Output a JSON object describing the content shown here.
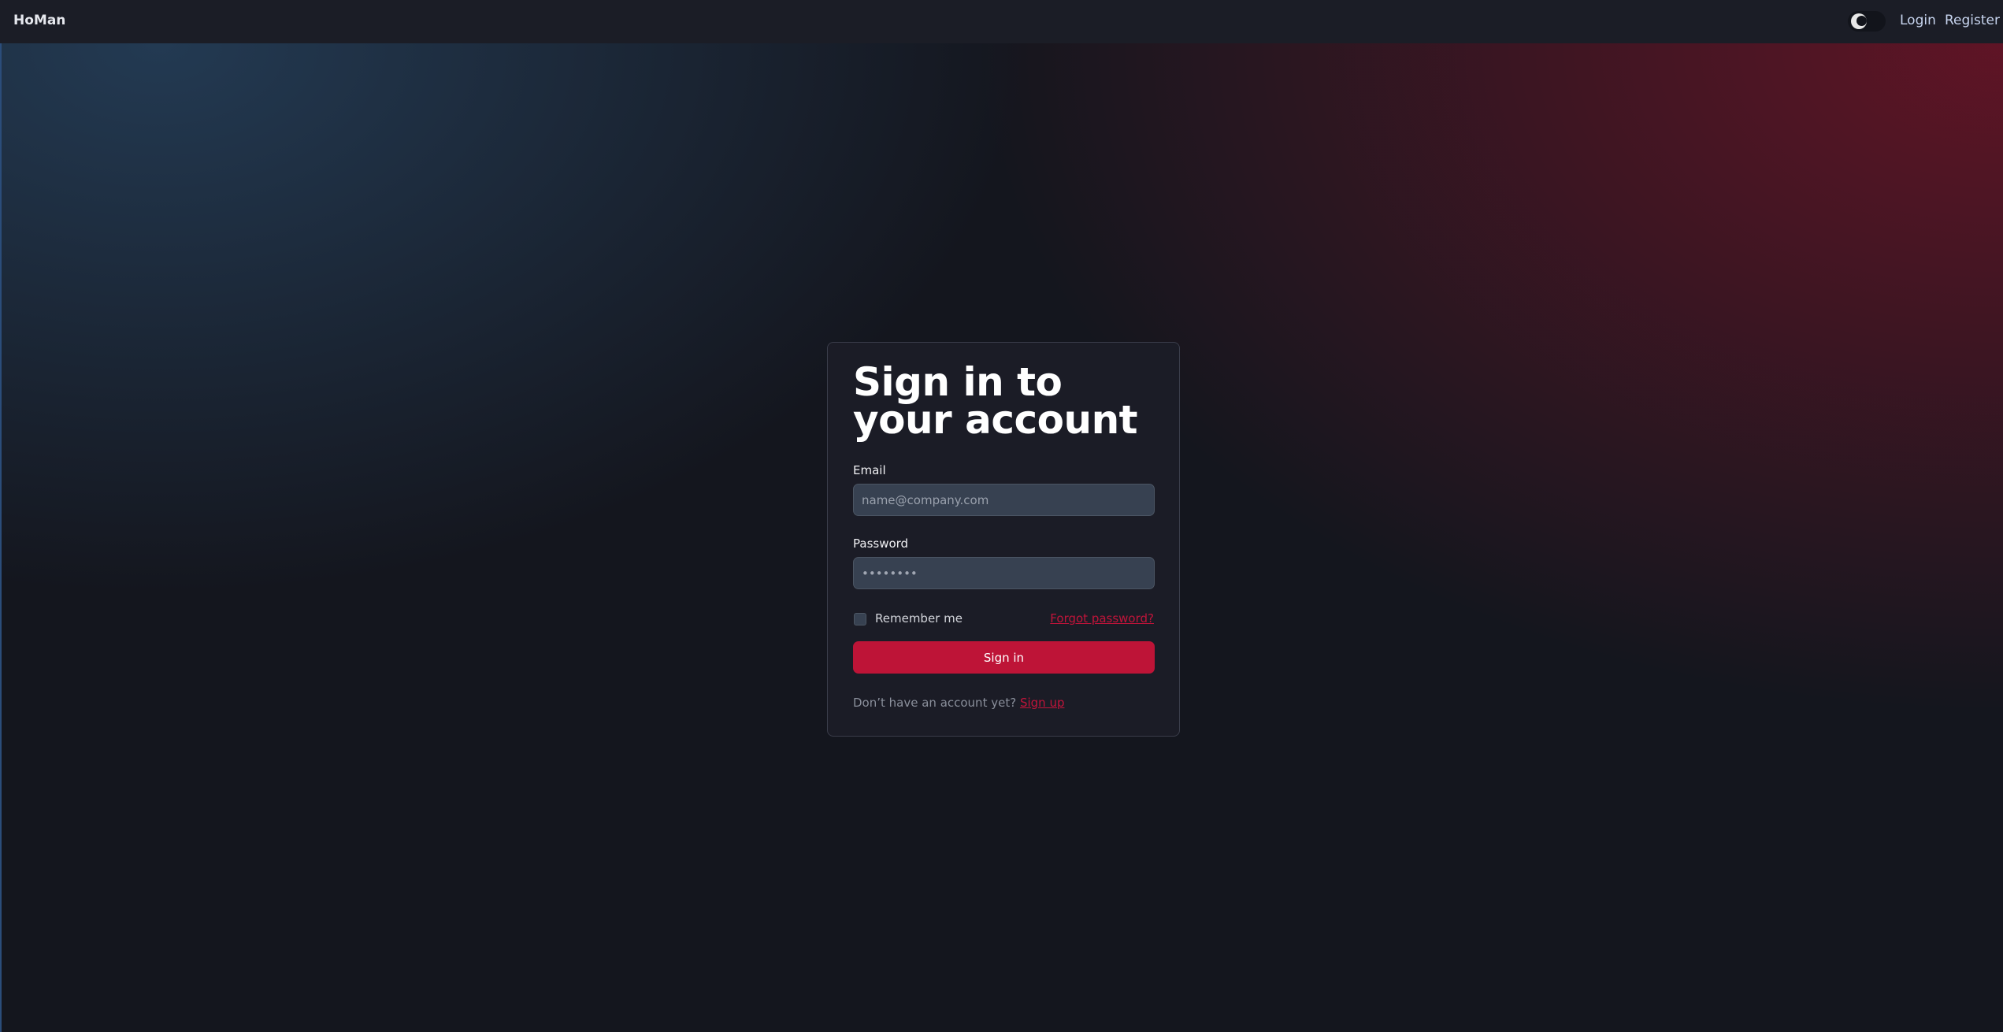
{
  "nav": {
    "brand": "HoMan",
    "theme_toggle_icon": "moon-icon",
    "login": "Login",
    "register": "Register"
  },
  "form": {
    "title": "Sign in to your account",
    "email_label": "Email",
    "email_placeholder": "name@company.com",
    "password_label": "Password",
    "password_value": "••••••••",
    "remember_label": "Remember me",
    "forgot_label": "Forgot password?",
    "submit_label": "Sign in",
    "signup_prompt": "Don’t have an account yet?",
    "signup_link": "Sign up"
  },
  "colors": {
    "accent": "#be1437",
    "background": "#14161e",
    "card": "#1b1c26"
  }
}
